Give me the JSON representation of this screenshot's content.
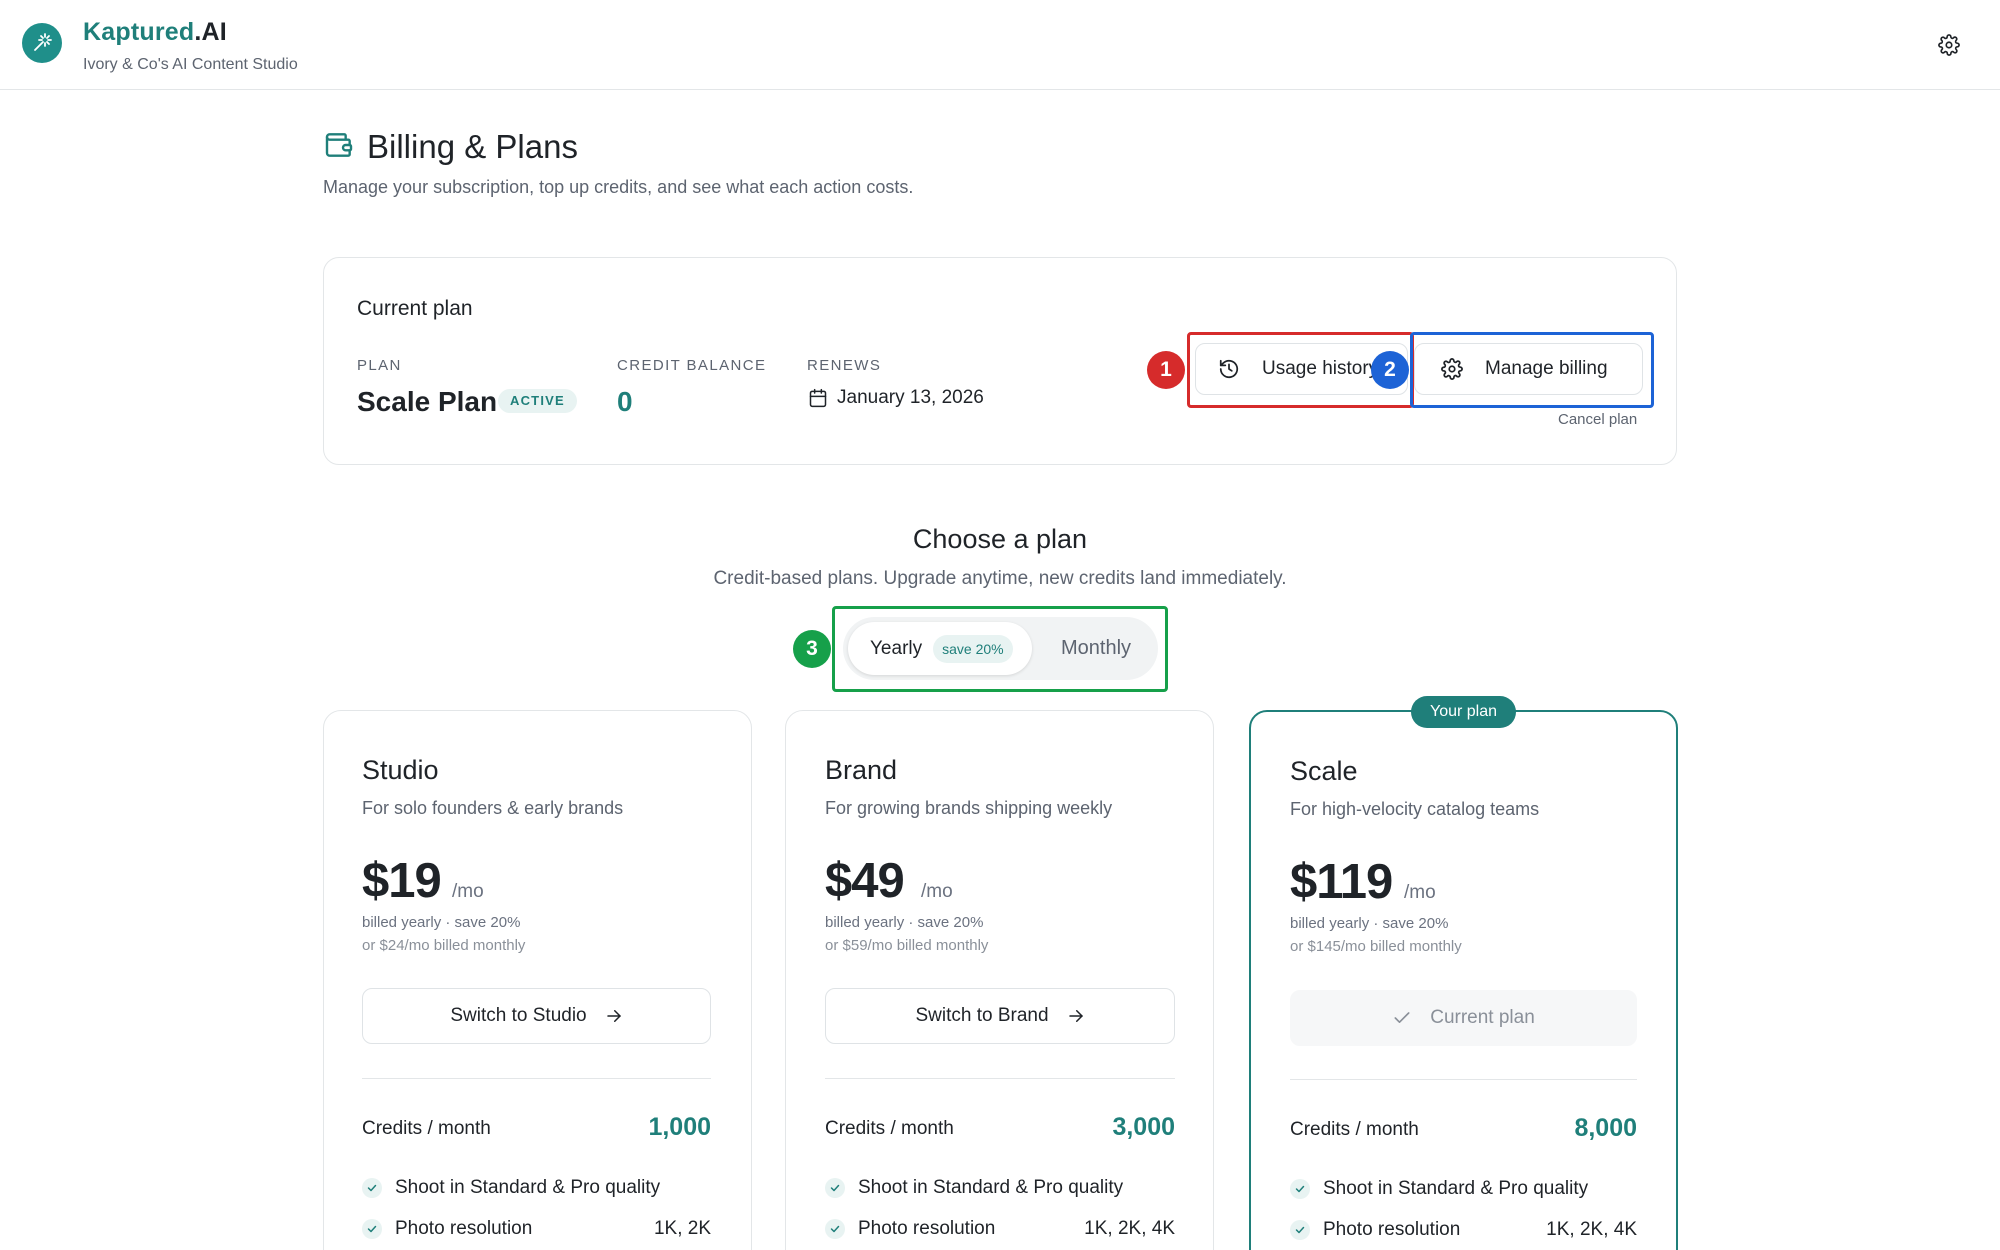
{
  "app": {
    "name_main": "Kaptured",
    "name_suffix": ".AI",
    "subtitle": "Ivory & Co's AI Content Studio",
    "logo_icon": "sparkle-wand-icon",
    "settings_icon": "gear-icon"
  },
  "page": {
    "title": "Billing & Plans",
    "subtitle": "Manage your subscription, top up credits, and see what each action costs.",
    "icon": "wallet-icon"
  },
  "current_plan": {
    "heading": "Current plan",
    "plan_label": "PLAN",
    "plan_name": "Scale Plan",
    "status": "ACTIVE",
    "credit_label": "CREDIT BALANCE",
    "credit_balance": "0",
    "renews_label": "RENEWS",
    "renews_date": "January 13, 2026",
    "usage_button": "Usage history",
    "manage_button": "Manage billing",
    "cancel_link": "Cancel plan"
  },
  "annotations": [
    "1",
    "2",
    "3"
  ],
  "choose": {
    "title": "Choose a plan",
    "subtitle": "Credit-based plans. Upgrade anytime, new credits land immediately.",
    "toggle_yearly": "Yearly",
    "toggle_save": "save 20%",
    "toggle_monthly": "Monthly",
    "selected": "Yearly"
  },
  "plans": [
    {
      "name": "Studio",
      "desc": "For solo founders & early brands",
      "price": "$19",
      "per": "/mo",
      "billed": "billed yearly · save 20%",
      "alt": "or $24/mo billed monthly",
      "button": "Switch to Studio",
      "credits_label": "Credits / month",
      "credits": "1,000",
      "features": [
        {
          "label": "Shoot in Standard & Pro quality",
          "value": ""
        },
        {
          "label": "Photo resolution",
          "value": "1K, 2K"
        }
      ]
    },
    {
      "name": "Brand",
      "desc": "For growing brands shipping weekly",
      "price": "$49",
      "per": "/mo",
      "billed": "billed yearly · save 20%",
      "alt": "or $59/mo billed monthly",
      "button": "Switch to Brand",
      "credits_label": "Credits / month",
      "credits": "3,000",
      "features": [
        {
          "label": "Shoot in Standard & Pro quality",
          "value": ""
        },
        {
          "label": "Photo resolution",
          "value": "1K, 2K, 4K"
        }
      ]
    },
    {
      "name": "Scale",
      "badge": "Your plan",
      "desc": "For high-velocity catalog teams",
      "price": "$119",
      "per": "/mo",
      "billed": "billed yearly · save 20%",
      "alt": "or $145/mo billed monthly",
      "button": "Current plan",
      "credits_label": "Credits / month",
      "credits": "8,000",
      "features": [
        {
          "label": "Shoot in Standard & Pro quality",
          "value": ""
        },
        {
          "label": "Photo resolution",
          "value": "1K, 2K, 4K"
        }
      ]
    }
  ],
  "colors": {
    "accent": "#1f7f7a",
    "annotation_red": "#d62b2b",
    "annotation_blue": "#1d63d6",
    "annotation_green": "#16a04a"
  }
}
